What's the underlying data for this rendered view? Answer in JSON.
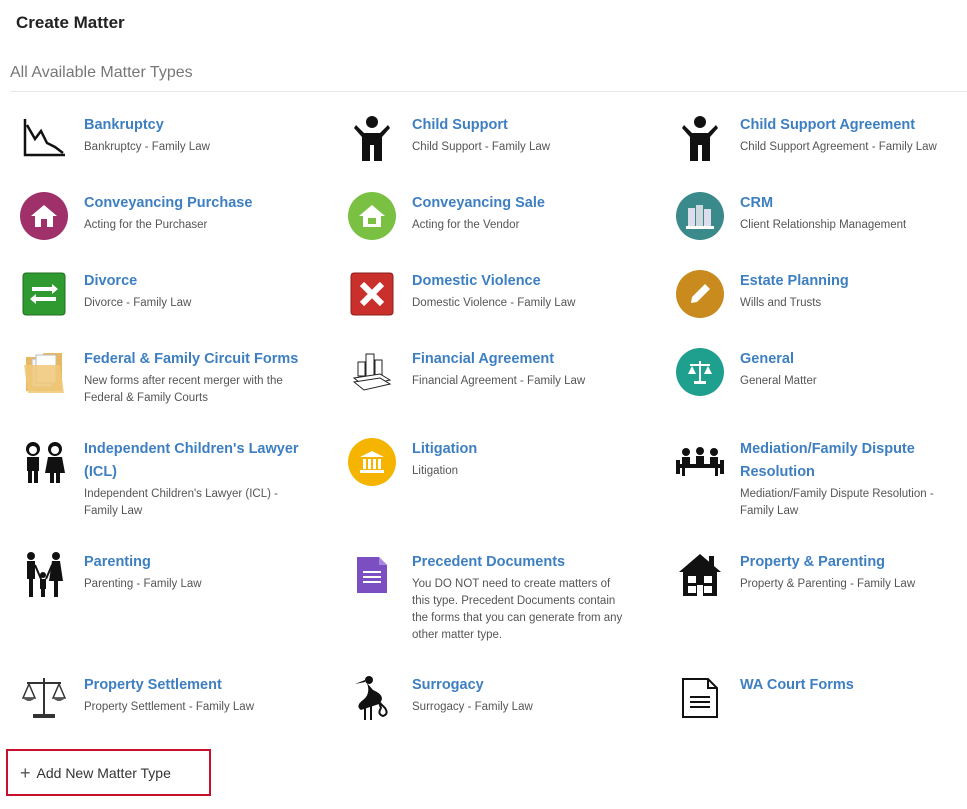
{
  "page": {
    "title": "Create Matter",
    "section": "All Available Matter Types"
  },
  "matters": [
    {
      "name": "Bankruptcy",
      "desc": "Bankruptcy - Family Law",
      "icon": "bankruptcy-chart-icon"
    },
    {
      "name": "Child Support",
      "desc": "Child Support - Family Law",
      "icon": "child-icon"
    },
    {
      "name": "Child Support Agreement",
      "desc": "Child Support Agreement - Family Law",
      "icon": "child-icon"
    },
    {
      "name": "Conveyancing Purchase",
      "desc": "Acting for the Purchaser",
      "icon": "house-icon",
      "color": "#a0306a"
    },
    {
      "name": "Conveyancing Sale",
      "desc": "Acting for the Vendor",
      "icon": "house-icon",
      "color": "#7ac143"
    },
    {
      "name": "CRM",
      "desc": "Client Relationship Management",
      "icon": "binders-icon",
      "color": "#3a8a8c"
    },
    {
      "name": "Divorce",
      "desc": "Divorce - Family Law",
      "icon": "arrows-icon",
      "color": "#2f9a2f"
    },
    {
      "name": "Domestic Violence",
      "desc": "Domestic Violence - Family Law",
      "icon": "x-icon",
      "color": "#c9302c"
    },
    {
      "name": "Estate Planning",
      "desc": "Wills and Trusts",
      "icon": "pen-icon",
      "color": "#c98a1e"
    },
    {
      "name": "Federal & Family Circuit Forms",
      "desc": "New forms after recent merger with the Federal & Family Courts",
      "icon": "folder-icon"
    },
    {
      "name": "Financial Agreement",
      "desc": "Financial Agreement - Family Law",
      "icon": "money-city-icon"
    },
    {
      "name": "General",
      "desc": "General Matter",
      "icon": "scales-icon",
      "color": "#1f9f8e"
    },
    {
      "name": "Independent Children's Lawyer (ICL)",
      "desc": "Independent Children's Lawyer (ICL) - Family Law",
      "icon": "children-icon"
    },
    {
      "name": "Litigation",
      "desc": "Litigation",
      "icon": "courthouse-icon",
      "color": "#f5b400"
    },
    {
      "name": "Mediation/Family Dispute Resolution",
      "desc": "Mediation/Family Dispute Resolution - Family Law",
      "icon": "meeting-icon"
    },
    {
      "name": "Parenting",
      "desc": "Parenting - Family Law",
      "icon": "family-icon"
    },
    {
      "name": "Precedent Documents",
      "desc": "You DO NOT need to create matters of this type. Precedent Documents contain the forms that you can generate from any other matter type.",
      "icon": "document-icon",
      "color": "#7b4fc2"
    },
    {
      "name": "Property & Parenting",
      "desc": "Property & Parenting - Family Law",
      "icon": "home-icon"
    },
    {
      "name": "Property Settlement",
      "desc": "Property Settlement - Family Law",
      "icon": "balance-scale-icon"
    },
    {
      "name": "Surrogacy",
      "desc": "Surrogacy - Family Law",
      "icon": "stork-icon"
    },
    {
      "name": "WA Court Forms",
      "desc": "",
      "icon": "form-icon"
    }
  ],
  "add_button": {
    "label": "Add New Matter Type",
    "icon": "plus-icon"
  }
}
